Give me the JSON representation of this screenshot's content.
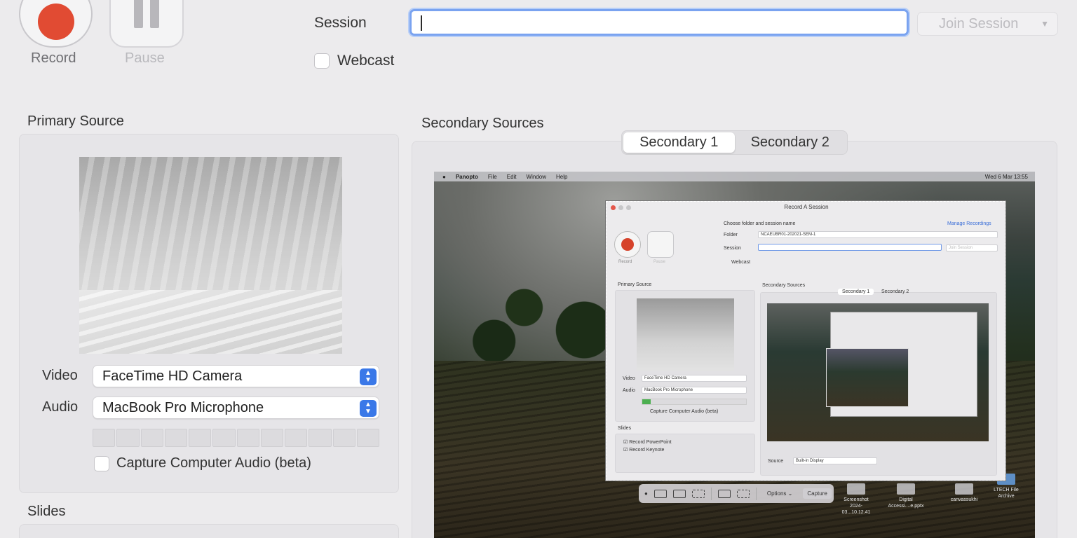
{
  "controls": {
    "record_label": "Record",
    "pause_label": "Pause",
    "session_label": "Session",
    "session_value": "",
    "join_label": "Join Session",
    "webcast_label": "Webcast",
    "webcast_checked": false
  },
  "primary": {
    "title": "Primary Source",
    "video_label": "Video",
    "video_value": "FaceTime HD Camera",
    "audio_label": "Audio",
    "audio_value": "MacBook Pro Microphone",
    "audio_level_segments": 12,
    "capture_audio_label": "Capture Computer Audio (beta)",
    "capture_audio_checked": false
  },
  "slides": {
    "title": "Slides"
  },
  "secondary": {
    "title": "Secondary Sources",
    "tabs": [
      {
        "label": "Secondary 1",
        "active": true
      },
      {
        "label": "Secondary 2",
        "active": false
      }
    ]
  },
  "preview": {
    "menubar": {
      "app": "Panopto",
      "items": [
        "File",
        "Edit",
        "Window",
        "Help"
      ],
      "clock": "Wed 6 Mar  13:55"
    },
    "window": {
      "title": "Record A Session",
      "choose_label": "Choose folder and session name",
      "manage_link": "Manage Recordings",
      "folder_label": "Folder",
      "folder_value": "NCAEUBR01-202021-SEM-1",
      "session_label": "Session",
      "join_label": "Join Session",
      "webcast_label": "Webcast",
      "record_label": "Record",
      "pause_label": "Pause",
      "primary_title": "Primary Source",
      "video_label": "Video",
      "video_value": "FaceTime HD Camera",
      "audio_label": "Audio",
      "audio_value": "MacBook Pro Microphone",
      "capture_label": "Capture Computer Audio (beta)",
      "secondary_title": "Secondary Sources",
      "tab1": "Secondary 1",
      "tab2": "Secondary 2",
      "slides_title": "Slides",
      "slides_ppt": "Record PowerPoint",
      "slides_keynote": "Record Keynote",
      "source_label": "Source",
      "source_value": "Built-in Display"
    },
    "toolbar": {
      "options_label": "Options",
      "capture_label": "Capture"
    },
    "desktop_icons": [
      {
        "label": "Screenshot 2024-03...10.12.41"
      },
      {
        "label": "Digital Accessi....e.pptx"
      },
      {
        "label": "canvassukhi"
      },
      {
        "label": "LTECH File Archive"
      }
    ]
  },
  "colors": {
    "record_red": "#e14b33",
    "accent_blue": "#3a78e8",
    "focus_ring": "#7aa3f0"
  }
}
